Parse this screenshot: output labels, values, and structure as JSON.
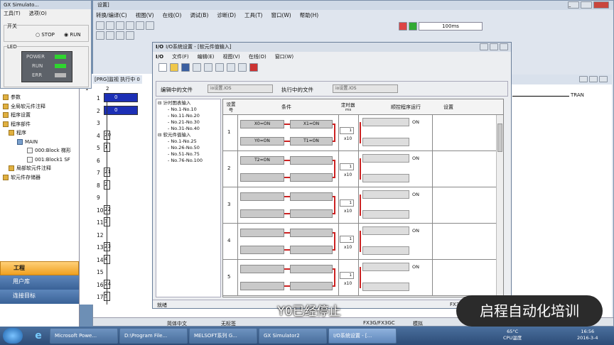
{
  "gxsim": {
    "title": "GX Simulato...",
    "menu": [
      "工具(T)",
      "选项(O)"
    ],
    "switch_label": "开关",
    "stop": "STOP",
    "run": "RUN",
    "led_label": "LED",
    "leds": [
      {
        "name": "POWER",
        "color": "#2fd52f"
      },
      {
        "name": "RUN",
        "color": "#2fd52f"
      },
      {
        "name": "ERR",
        "color": "#b8b8b8"
      }
    ]
  },
  "main": {
    "title_tail": "设置]",
    "menu": [
      "转换/编译(C)",
      "视图(V)",
      "在线(O)",
      "调试(B)",
      "诊断(D)",
      "工具(T)",
      "窗口(W)",
      "帮助(H)"
    ],
    "speed": "100ms",
    "tab": "[PRG]监视 执行中 0",
    "tran": "TRAN",
    "status_bar": [
      "简体中文",
      "无标签",
      "FX3G/FX3GC",
      "模拟"
    ]
  },
  "nav": {
    "items": [
      "参数",
      "全局软元件注释",
      "程序设置",
      "程序部件",
      "程序",
      "MAIN",
      "000:Block 梯形",
      "001:Block1 SF",
      "局部软元件注释",
      "软元件存储器"
    ],
    "panels": [
      "工程",
      "用户库",
      "连接目标"
    ]
  },
  "ladder": {
    "header": [
      "1",
      "2"
    ],
    "steps": [
      "1",
      "2",
      "3",
      "4",
      "5",
      "6",
      "7",
      "8",
      "9",
      "10",
      "11",
      "12",
      "13",
      "14",
      "15",
      "16",
      "17"
    ],
    "cols": [
      "0",
      "0",
      "",
      "20",
      "1",
      "",
      "21",
      "2",
      "",
      "22",
      "3",
      "",
      "23",
      "4",
      "",
      "24",
      "5"
    ]
  },
  "io": {
    "title": "I/O系统设置 - [软元件值输入]",
    "menu": [
      "文件(F)",
      "编辑(E)",
      "视图(V)",
      "在线(O)",
      "窗口(W)"
    ],
    "edit_label": "编辑中的文件",
    "edit_value": "io设置.IOS",
    "exec_label": "执行中的文件",
    "exec_value": "io设置.IOS",
    "tree": [
      "计时图表输入",
      "No.1-No.10",
      "No.11-No.20",
      "No.21-No.30",
      "No.31-No.40",
      "软元件值输入",
      "No.1-No.25",
      "No.26-No.50",
      "No.51-No.75",
      "No.76-No.100"
    ],
    "headers": {
      "num": "设置号",
      "cond": "条件",
      "timer": "定时器",
      "timer_unit": "ms",
      "seq": "顺控程序运行",
      "set": "设置"
    },
    "rows": [
      {
        "n": "1",
        "c1": "X0=ON",
        "c2": "X1=ON",
        "c3": "Y0=ON",
        "c4": "T1=ON",
        "t": "1",
        "x": "x10",
        "on": "ON"
      },
      {
        "n": "2",
        "c1": "T2=ON",
        "c2": "",
        "c3": "",
        "c4": "",
        "t": "1",
        "x": "x10",
        "on": "ON"
      },
      {
        "n": "3",
        "c1": "",
        "c2": "",
        "c3": "",
        "c4": "",
        "t": "1",
        "x": "x10",
        "on": "ON"
      },
      {
        "n": "4",
        "c1": "",
        "c2": "",
        "c3": "",
        "c4": "",
        "t": "1",
        "x": "x10",
        "on": "ON"
      },
      {
        "n": "5",
        "c1": "",
        "c2": "",
        "c3": "",
        "c4": "",
        "t": "1",
        "x": "x10",
        "on": "ON"
      }
    ],
    "status": "就绪",
    "model": "FX3G"
  },
  "subtitle": "Y0已经停止",
  "watermark": "启程自动化培训",
  "taskbar": {
    "items": [
      "Microsoft Powe...",
      "D:\\Program File...",
      "MELSOFT系列 G...",
      "GX Simulator2",
      "I/O系统设置 - [..."
    ],
    "temp": "65°C",
    "cpu": "CPU温度",
    "time": "16:56",
    "date": "2016-3-4"
  }
}
